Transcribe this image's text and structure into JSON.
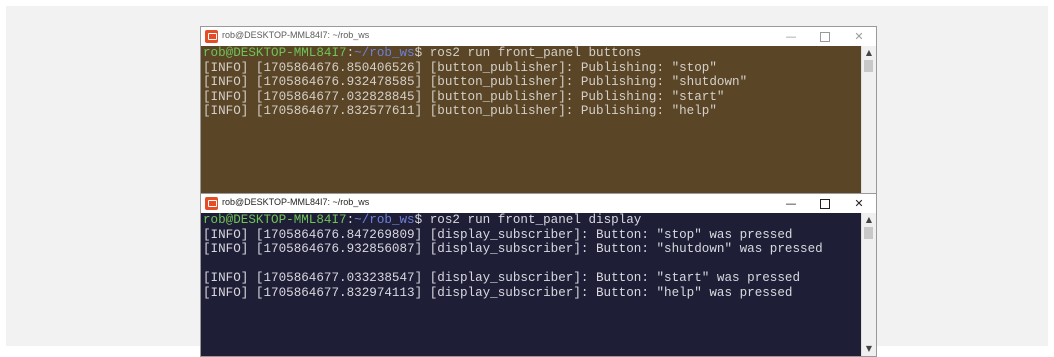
{
  "windows": [
    {
      "title": "rob@DESKTOP-MML84I7: ~/rob_ws",
      "controls": {
        "minimize": "—",
        "maximize": "☐",
        "close": "✕"
      },
      "prompt": {
        "user_host": "rob@DESKTOP-MML84I7",
        "sep": ":",
        "path": "~/rob_ws",
        "symbol": "$",
        "command": " ros2 run front_panel buttons"
      },
      "lines": [
        "[INFO] [1705864676.850406526] [button_publisher]: Publishing: \"stop\"",
        "[INFO] [1705864676.932478585] [button_publisher]: Publishing: \"shutdown\"",
        "[INFO] [1705864677.032828845] [button_publisher]: Publishing: \"start\"",
        "[INFO] [1705864677.832577611] [button_publisher]: Publishing: \"help\""
      ],
      "colors": {
        "background": "#5a4527",
        "text": "#d4d0c8"
      }
    },
    {
      "title": "rob@DESKTOP-MML84I7: ~/rob_ws",
      "controls": {
        "minimize": "—",
        "maximize": "☐",
        "close": "✕"
      },
      "prompt": {
        "user_host": "rob@DESKTOP-MML84I7",
        "sep": ":",
        "path": "~/rob_ws",
        "symbol": "$",
        "command": " ros2 run front_panel display"
      },
      "lines": [
        "[INFO] [1705864676.847269809] [display_subscriber]: Button: \"stop\" was pressed",
        "[INFO] [1705864676.932856087] [display_subscriber]: Button: \"shutdown\" was pressed",
        "",
        "[INFO] [1705864677.033238547] [display_subscriber]: Button: \"start\" was pressed",
        "[INFO] [1705864677.832974113] [display_subscriber]: Button: \"help\" was pressed"
      ],
      "colors": {
        "background": "#1f1e37",
        "text": "#d8d8de"
      }
    }
  ],
  "icons": {
    "app": "terminal-app-icon",
    "scroll_up": "chevron-up-icon",
    "scroll_down": "chevron-down-icon"
  }
}
